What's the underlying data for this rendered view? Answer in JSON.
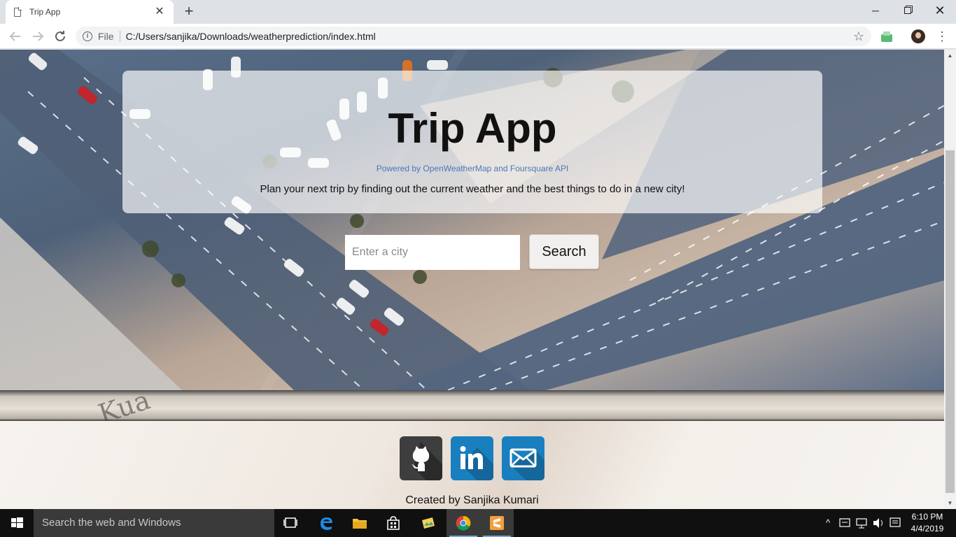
{
  "browser": {
    "tab_title": "Trip App",
    "tab_close": "✕",
    "new_tab": "+",
    "window_minimize": "─",
    "window_close": "✕",
    "omnibox_scheme": "File",
    "url": "C:/Users/sanjika/Downloads/weatherprediction/index.html"
  },
  "page": {
    "title": "Trip App",
    "subtitle": "Powered by OpenWeatherMap and Foursquare API",
    "tagline": "Plan your next trip by finding out the current weather and the best things to do in a new city!",
    "search_placeholder": "Enter a city",
    "search_value": "",
    "search_button": "Search",
    "band_text": "Kua",
    "credit": "Created by Sanjika Kumari",
    "social_icons": [
      "github-icon",
      "linkedin-icon",
      "email-icon"
    ]
  },
  "taskbar": {
    "search_placeholder": "Search the web and Windows",
    "time": "6:10 PM",
    "date": "4/4/2019"
  },
  "colors": {
    "github": "#3e3e3e",
    "linkedin": "#1a7fbf",
    "email": "#1a7fbf",
    "subtitle": "#4a78b8"
  }
}
